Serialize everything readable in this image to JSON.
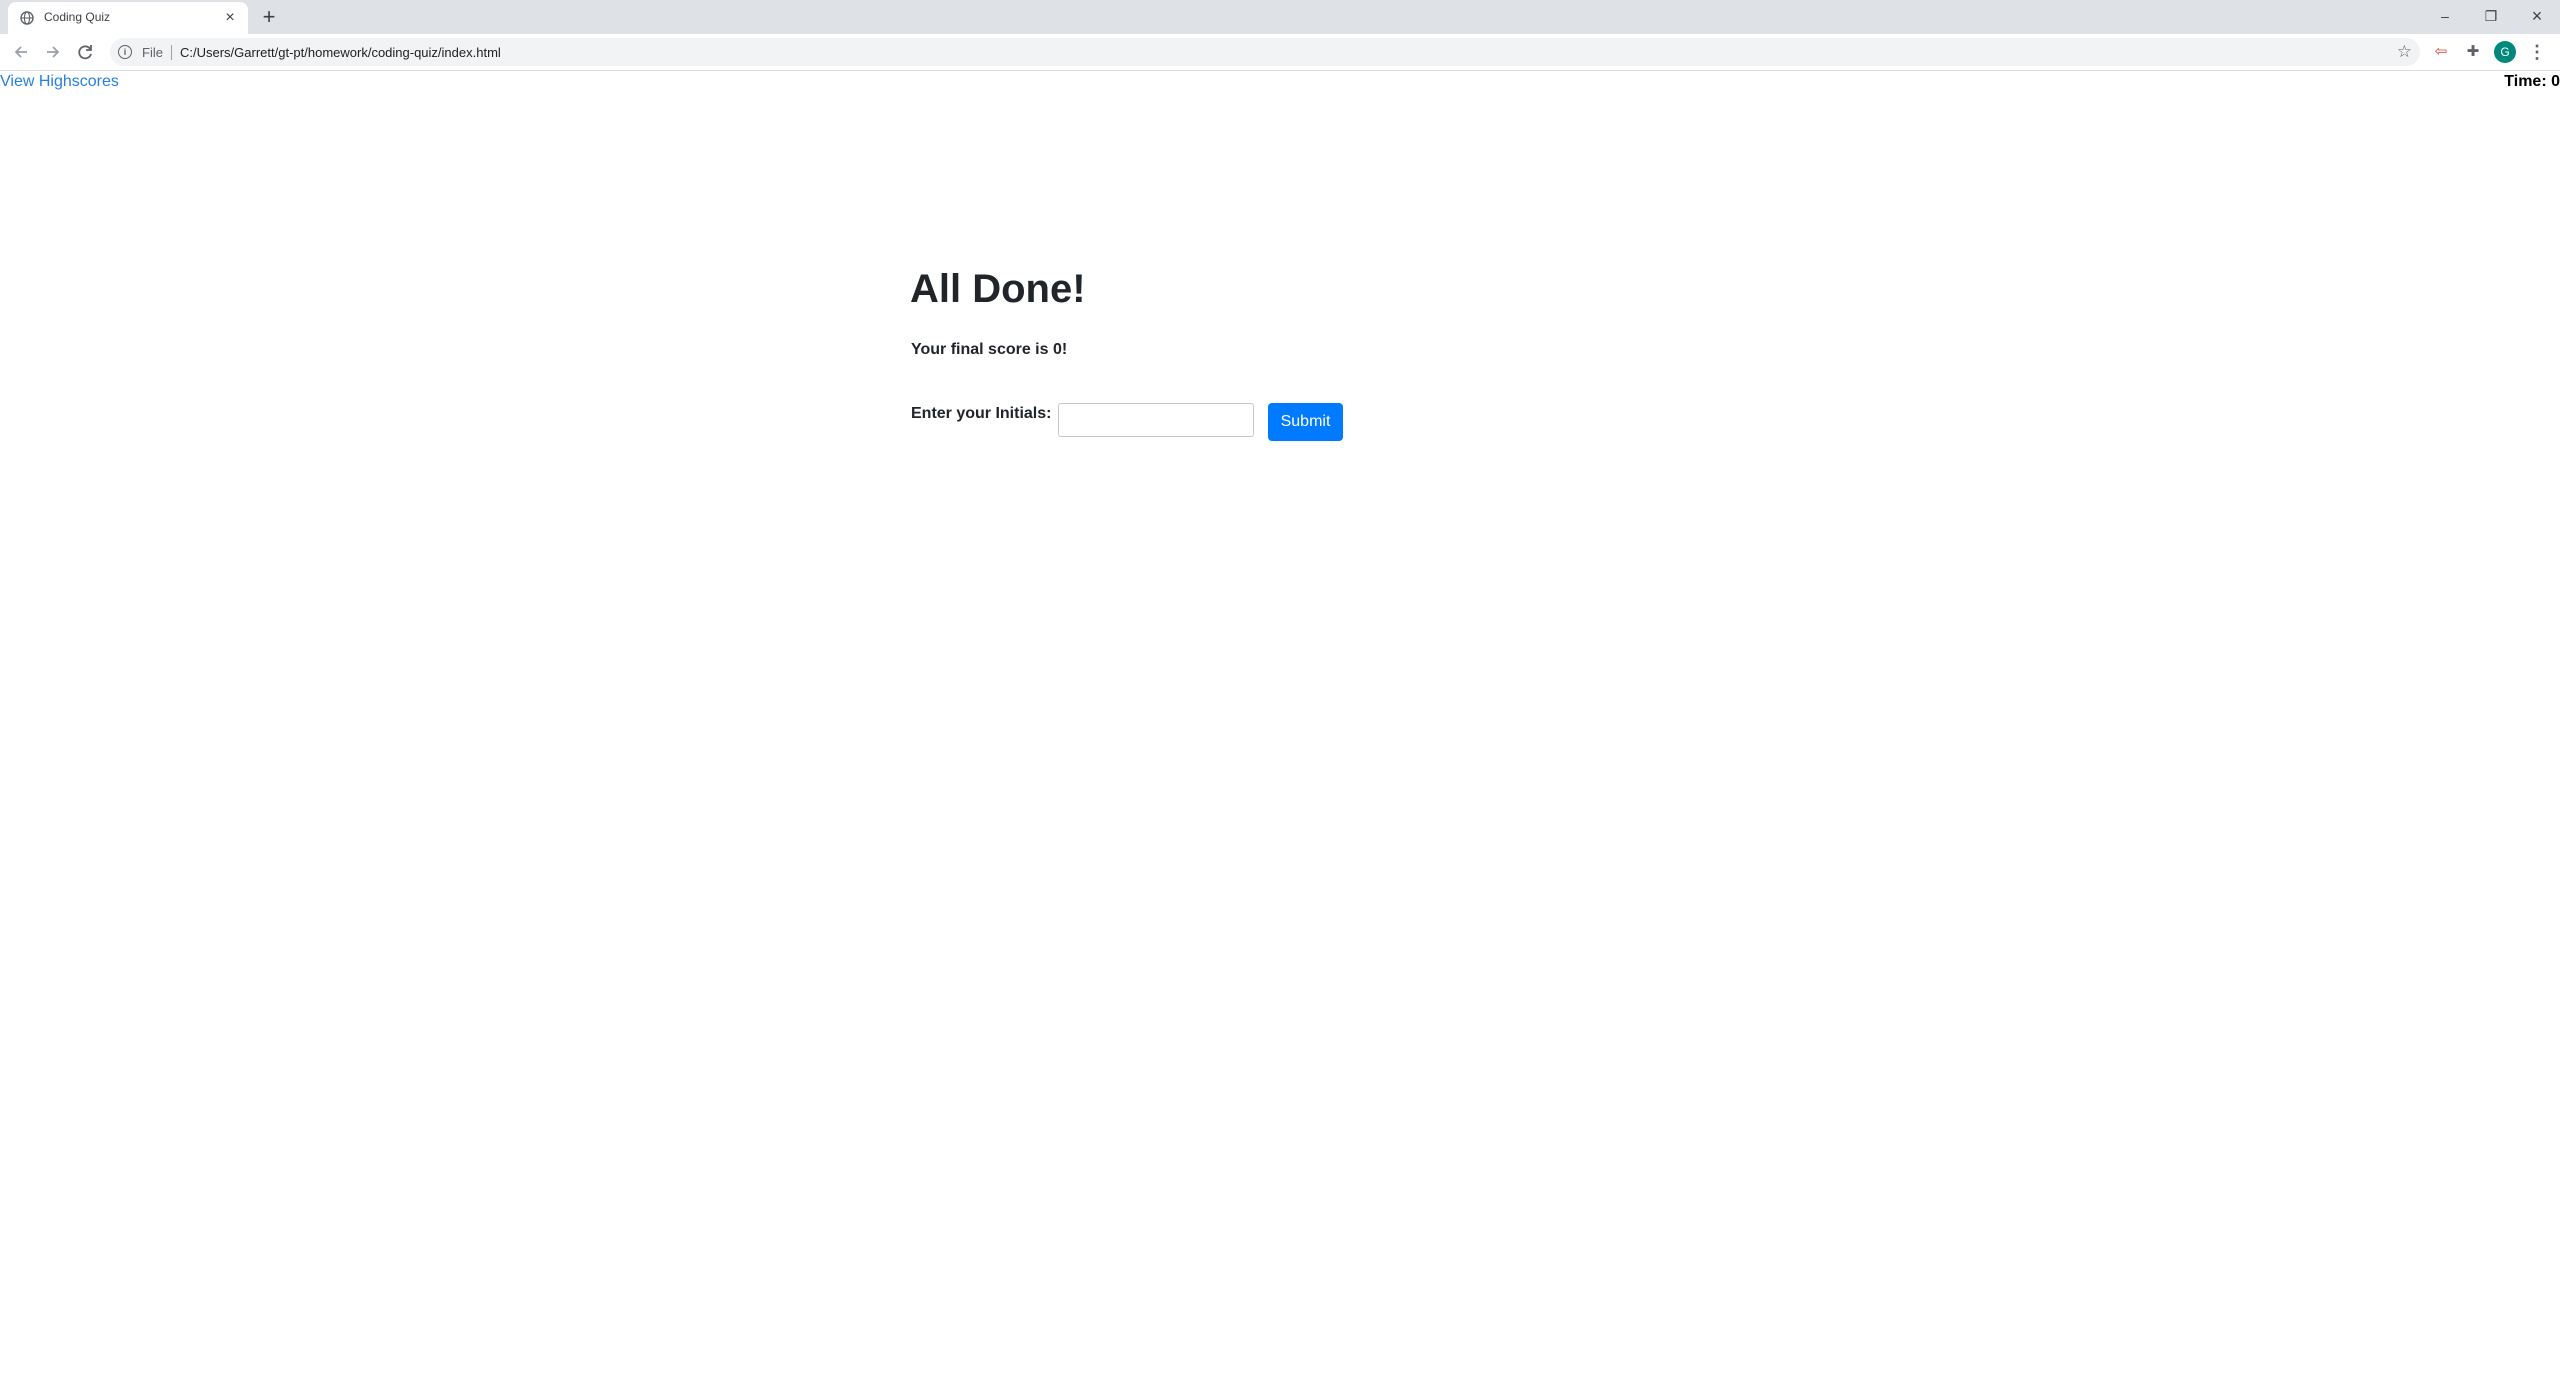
{
  "browser": {
    "tab": {
      "title": "Coding Quiz",
      "close_glyph": "×"
    },
    "new_tab_glyph": "+",
    "window_controls": {
      "minimize": "–",
      "restore": "❐",
      "close": "×"
    },
    "address_bar": {
      "scheme_label": "File",
      "url": "C:/Users/Garrett/gt-pt/homework/coding-quiz/index.html"
    },
    "profile_initial": "G",
    "icons": [
      "globe-icon",
      "back-icon",
      "forward-icon",
      "reload-icon",
      "info-icon",
      "star-icon",
      "extension-icon",
      "puzzle-icon",
      "menu-icon"
    ]
  },
  "page": {
    "highscores_link": "View Highscores",
    "timer": "Time: 0",
    "heading": "All Done!",
    "score_message": "Your final score is 0!",
    "initials_label": "Enter your Initials:",
    "initials_value": "",
    "submit_label": "Submit"
  },
  "colors": {
    "link": "#2680e3",
    "submit_button": "#007bff",
    "text": "#212529",
    "tabstrip": "#dee1e6",
    "avatar": "#00897b"
  }
}
